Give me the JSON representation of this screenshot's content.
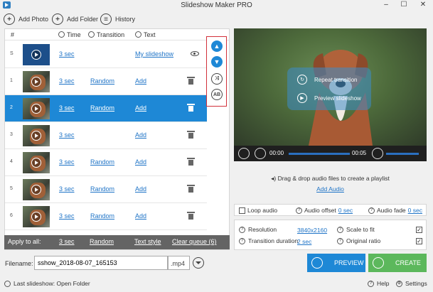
{
  "window": {
    "title": "Slideshow Maker PRO"
  },
  "toolbar": {
    "add_photo": "Add Photo",
    "add_folder": "Add Folder",
    "history": "History"
  },
  "table": {
    "headers": {
      "num": "#",
      "time": "Time",
      "transition": "Transition",
      "text": "Text"
    },
    "rows": [
      {
        "num": "S",
        "time": "3 sec",
        "transition": "",
        "text": "My slideshow"
      },
      {
        "num": "1",
        "time": "3 sec",
        "transition": "Random",
        "text": "Add"
      },
      {
        "num": "2",
        "time": "3 sec",
        "transition": "Random",
        "text": "Add"
      },
      {
        "num": "3",
        "time": "3 sec",
        "transition": "",
        "text": "Add"
      },
      {
        "num": "4",
        "time": "3 sec",
        "transition": "Random",
        "text": "Add"
      },
      {
        "num": "5",
        "time": "3 sec",
        "transition": "Random",
        "text": "Add"
      },
      {
        "num": "6",
        "time": "3 sec",
        "transition": "Random",
        "text": "Add"
      }
    ]
  },
  "sidebox": {
    "shuffle_icon": "shuffle-icon",
    "ab_label": "AB"
  },
  "apply_bar": {
    "label": "Apply to all:",
    "time": "3 sec",
    "transition": "Random",
    "text_style": "Text style",
    "clear": "Clear queue (6)"
  },
  "preview": {
    "repeat_transition": "Repeat transition",
    "preview_slideshow": "Preview slideshow",
    "time_current": "00:00",
    "time_total": "00:05"
  },
  "audio": {
    "drop_text": "Drag & drop audio files to create a playlist",
    "add_audio": "Add Audio",
    "loop_audio": "Loop audio",
    "audio_offset_label": "Audio offset",
    "audio_offset_value": "0 sec",
    "audio_fade_label": "Audio fade",
    "audio_fade_value": "0 sec"
  },
  "settings": {
    "resolution_label": "Resolution",
    "resolution_value": "3840x2160",
    "transition_duration_label": "Transition duration",
    "transition_duration_value": "2 sec",
    "scale_to_fit": "Scale to fit",
    "original_ratio": "Original ratio"
  },
  "output": {
    "filename_label": "Filename:",
    "filename_value": "sshow_2018-08-07_165153",
    "extension": ".mp4",
    "preview_button": "PREVIEW",
    "create_button": "CREATE"
  },
  "status": {
    "last_slideshow": "Last slideshow: Open Folder",
    "help": "Help",
    "settings": "Settings"
  },
  "colors": {
    "accent": "#1e88d6",
    "preview_btn": "#1e88d6",
    "create_btn": "#5cb85c",
    "highlight_border": "#d2303a"
  }
}
